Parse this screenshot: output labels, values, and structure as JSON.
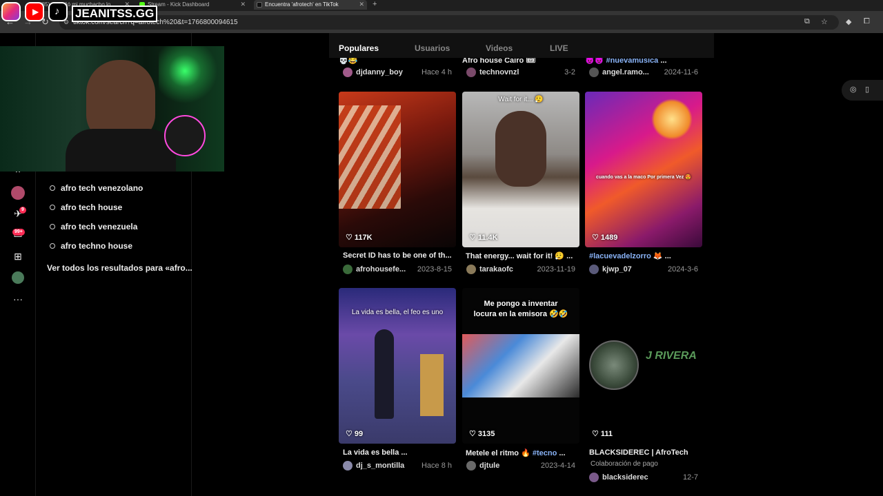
{
  "browser": {
    "tabs": [
      {
        "label": "(85) sucedió mi muchacho lo",
        "color": "#ff0000"
      },
      {
        "label": "Stream - Kick Dashboard",
        "color": "#53fc18"
      },
      {
        "label": "Encuentra 'afrotech' en TikTok",
        "color": "#111111"
      }
    ],
    "url": "tiktok.com/search?q=afrotech%20&t=1766800094615"
  },
  "overlay": {
    "handle": "JEANITSS.GG"
  },
  "sidebar": {
    "badges": {
      "inbox": "9",
      "messages": "99+"
    }
  },
  "search_panel": {
    "suggestions": [
      "afro tech venezolano",
      "afro tech house",
      "afro tech venezuela",
      "afro techno house"
    ],
    "see_all": "Ver todos los resultados para «afro..."
  },
  "results": {
    "tabs": [
      "Populares",
      "Usuarios",
      "Videos",
      "LIVE"
    ],
    "active_tab": "Populares",
    "top_row": [
      {
        "caption": "💀😂",
        "user": "djdanny_boy",
        "date": "Hace 4 h",
        "avatar": "#a05a8a"
      },
      {
        "caption": "Afro house Cairo 🎟",
        "user": "technovnzl",
        "date": "3-2",
        "avatar": "#7a4a6a"
      },
      {
        "caption": "😈😈 #nuevamusica ...",
        "user": "angel.ramo...",
        "date": "2024-11-6",
        "avatar": "#555555"
      }
    ],
    "videos": [
      {
        "likes": "117K",
        "caption": "Secret ID has to be one of th...",
        "user": "afrohousefe...",
        "date": "2023-8-15",
        "overlay": "",
        "avatar": "#3a6a3a"
      },
      {
        "likes": "11.4K",
        "caption": "That energy... wait for it! 😮‍💨 ...",
        "user": "tarakaofc",
        "date": "2023-11-19",
        "overlay": "Wait for it... 😮‍💨",
        "avatar": "#8a7a5a"
      },
      {
        "likes": "1489",
        "caption": "#lacuevadelzorro 🦊 ...",
        "user": "kjwp_07",
        "date": "2024-3-6",
        "overlay": "cuando vas a la maco Por primera Vez 😍",
        "avatar": "#5a5a7a"
      },
      {
        "likes": "99",
        "caption": "La vida es bella ...",
        "user": "dj_s_montilla",
        "date": "Hace 8 h",
        "overlay": "La vida es bella, el feo es uno",
        "avatar": "#8a8aaa"
      },
      {
        "likes": "3135",
        "caption": "Metele el ritmo 🔥 #tecno ...",
        "user": "djtule",
        "date": "2023-4-14",
        "overlay": "Me pongo a inventar locura en la emisora 🤣🤣",
        "avatar": "#6a6a6a"
      },
      {
        "likes": "111",
        "caption": "BLACKSIDEREC | AfroTech",
        "user": "blacksiderec",
        "date": "12-7",
        "overlay": "",
        "sponsor": "Colaboración de pago",
        "logo_text": "J RIVERA",
        "avatar": "#7a5a8a"
      }
    ]
  }
}
